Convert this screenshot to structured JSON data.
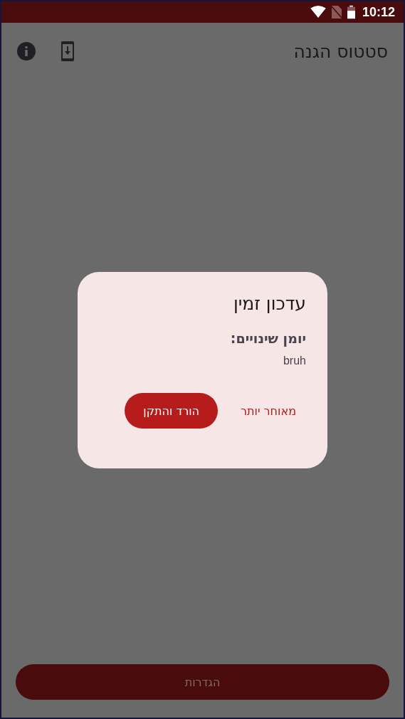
{
  "status_bar": {
    "time": "10:12"
  },
  "app_bar": {
    "title": "סטטוס הגנה"
  },
  "dialog": {
    "title": "עדכון זמין",
    "subtitle": "יומן שינויים:",
    "body": "bruh",
    "buttons": [
      {
        "label": "מאוחר יותר",
        "kind": "text"
      },
      {
        "label": "הורד והתקן",
        "kind": "filled"
      }
    ]
  },
  "bottom_button": {
    "label": "הגדרות"
  }
}
